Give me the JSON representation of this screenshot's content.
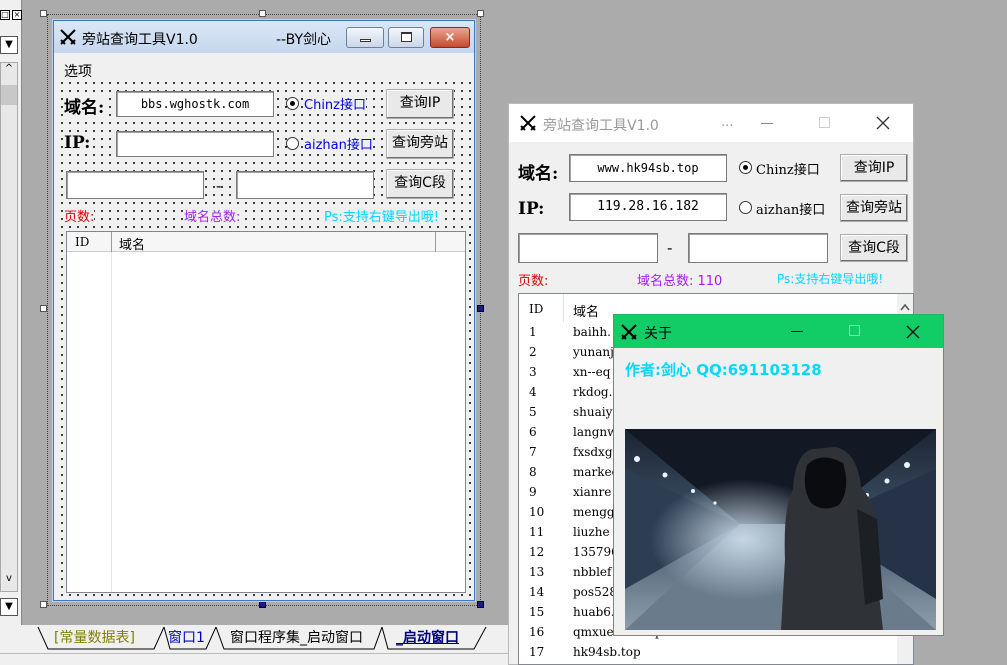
{
  "ide": {
    "close_glyph": "×",
    "restore_glyph": "□",
    "dropdown_glyph": "▼",
    "scroll_up_glyph": "^",
    "scroll_down_glyph": "v",
    "tabs": [
      {
        "label": "[常量数据表]",
        "color": "#808000"
      },
      {
        "label": "窗口1",
        "color": "#0000c0"
      },
      {
        "label": "窗口程序集_启动窗口",
        "color": "#000000"
      },
      {
        "label": "_启动窗口",
        "color": "#000080",
        "active": true
      }
    ]
  },
  "design_window": {
    "title": "旁站查询工具V1.0",
    "by": "--BY剑心",
    "menu_label": "选项",
    "domain_label": "域名:",
    "domain_value": "bbs.wghostk.com",
    "ip_label": "IP:",
    "ip_value": "",
    "radio_chinz": "Chinz接口",
    "radio_aizhan": "aizhan接口",
    "btn_query_ip": "查询IP",
    "btn_query_site": "查询旁站",
    "btn_query_c": "查询C段",
    "dash": "-",
    "pages_label": "页数:",
    "total_label": "域名总数:",
    "ps_label": "Ps:支持右键导出哦!",
    "col_id": "ID",
    "col_domain": "域名"
  },
  "run_window": {
    "title": "旁站查询工具V1.0",
    "title_dots": "...",
    "domain_label": "域名:",
    "domain_value": "www.hk94sb.top",
    "ip_label": "IP:",
    "ip_value": "119.28.16.182",
    "radio_chinz": "Chinz接口",
    "radio_aizhan": "aizhan接口",
    "btn_query_ip": "查询IP",
    "btn_query_site": "查询旁站",
    "btn_query_c": "查询C段",
    "dash": "-",
    "pages_label": "页数:",
    "total_label": "域名总数: 110",
    "ps_label": "Ps:支持右键导出哦!",
    "col_id": "ID",
    "col_domain": "域名",
    "rows": [
      {
        "id": "1",
        "domain": "baihh."
      },
      {
        "id": "2",
        "domain": "yunanj"
      },
      {
        "id": "3",
        "domain": "xn--eq"
      },
      {
        "id": "4",
        "domain": "rkdog."
      },
      {
        "id": "5",
        "domain": "shuaiy"
      },
      {
        "id": "6",
        "domain": "langnw"
      },
      {
        "id": "7",
        "domain": "fxsdxg"
      },
      {
        "id": "8",
        "domain": "markee"
      },
      {
        "id": "9",
        "domain": "xianre"
      },
      {
        "id": "10",
        "domain": "mengg."
      },
      {
        "id": "11",
        "domain": "liuzhe"
      },
      {
        "id": "12",
        "domain": "135796"
      },
      {
        "id": "13",
        "domain": "nbblef"
      },
      {
        "id": "14",
        "domain": "pos528"
      },
      {
        "id": "15",
        "domain": "huab6."
      },
      {
        "id": "16",
        "domain": "qmxuexiba.top"
      },
      {
        "id": "17",
        "domain": "hk94sb.top"
      }
    ]
  },
  "about_window": {
    "title": "关于",
    "author_text": "作者:剑心 QQ:691103128"
  },
  "colors": {
    "red": "#e00000",
    "purple": "#a020f0",
    "cyan": "#00d8ff",
    "about_green": "#12cd66",
    "blue_text": "#0000e0"
  }
}
